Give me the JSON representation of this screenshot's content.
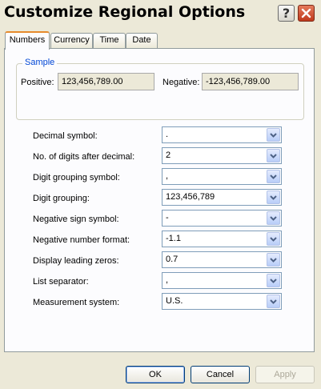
{
  "window": {
    "title": "Customize Regional Options",
    "help_label": "?"
  },
  "tabs": [
    {
      "label": "Numbers",
      "active": true
    },
    {
      "label": "Currency",
      "active": false
    },
    {
      "label": "Time",
      "active": false
    },
    {
      "label": "Date",
      "active": false
    }
  ],
  "sample": {
    "group_label": "Sample",
    "positive_label": "Positive:",
    "positive_value": "123,456,789.00",
    "negative_label": "Negative:",
    "negative_value": "-123,456,789.00"
  },
  "fields": [
    {
      "label": "Decimal symbol:",
      "value": "."
    },
    {
      "label": "No. of digits after decimal:",
      "value": "2"
    },
    {
      "label": "Digit grouping symbol:",
      "value": ","
    },
    {
      "label": "Digit grouping:",
      "value": "123,456,789"
    },
    {
      "label": "Negative sign symbol:",
      "value": "-"
    },
    {
      "label": "Negative number format:",
      "value": "-1.1"
    },
    {
      "label": "Display leading zeros:",
      "value": "0.7"
    },
    {
      "label": "List separator:",
      "value": ","
    },
    {
      "label": "Measurement system:",
      "value": "U.S."
    }
  ],
  "buttons": {
    "ok": "OK",
    "cancel": "Cancel",
    "apply": "Apply"
  },
  "colors": {
    "accent_tab": "#e68b2c",
    "group_label": "#0046d5",
    "close_button": "#c0391b"
  }
}
